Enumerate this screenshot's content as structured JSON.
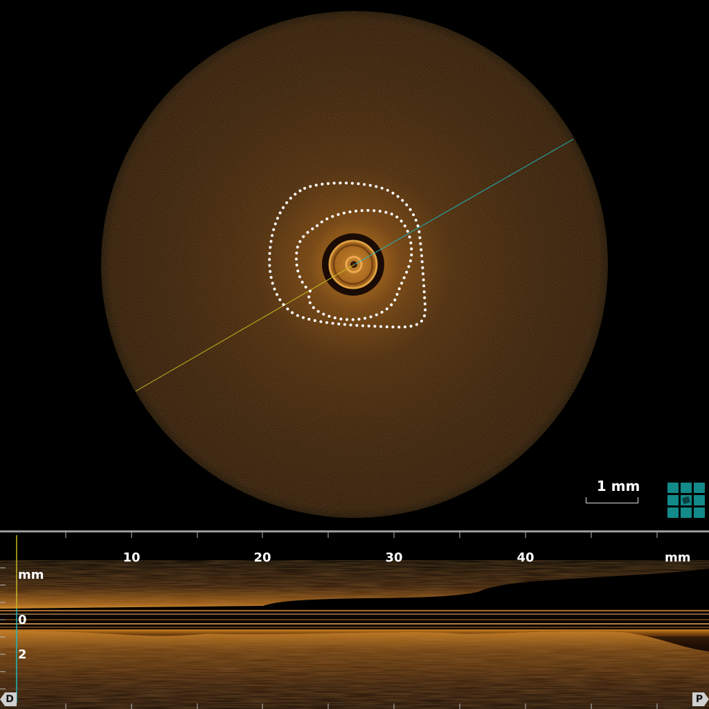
{
  "cross_section": {
    "scale_bar_label": "1 mm",
    "view_mode_icon": "grid-view-icon"
  },
  "longitudinal": {
    "axis_ticks": [
      "10",
      "20",
      "30",
      "40"
    ],
    "axis_unit": "mm",
    "depth_unit": "mm",
    "depth_ticks": [
      "0",
      "2"
    ],
    "distal_marker": "D",
    "proximal_marker": "P"
  },
  "colors": {
    "accent_teal": "#138a8a",
    "cut_line_teal": "#20b8c0",
    "cut_line_yellow": "#c8b820",
    "contour_white": "#ffffff",
    "tissue_orange": "#c8781a"
  }
}
